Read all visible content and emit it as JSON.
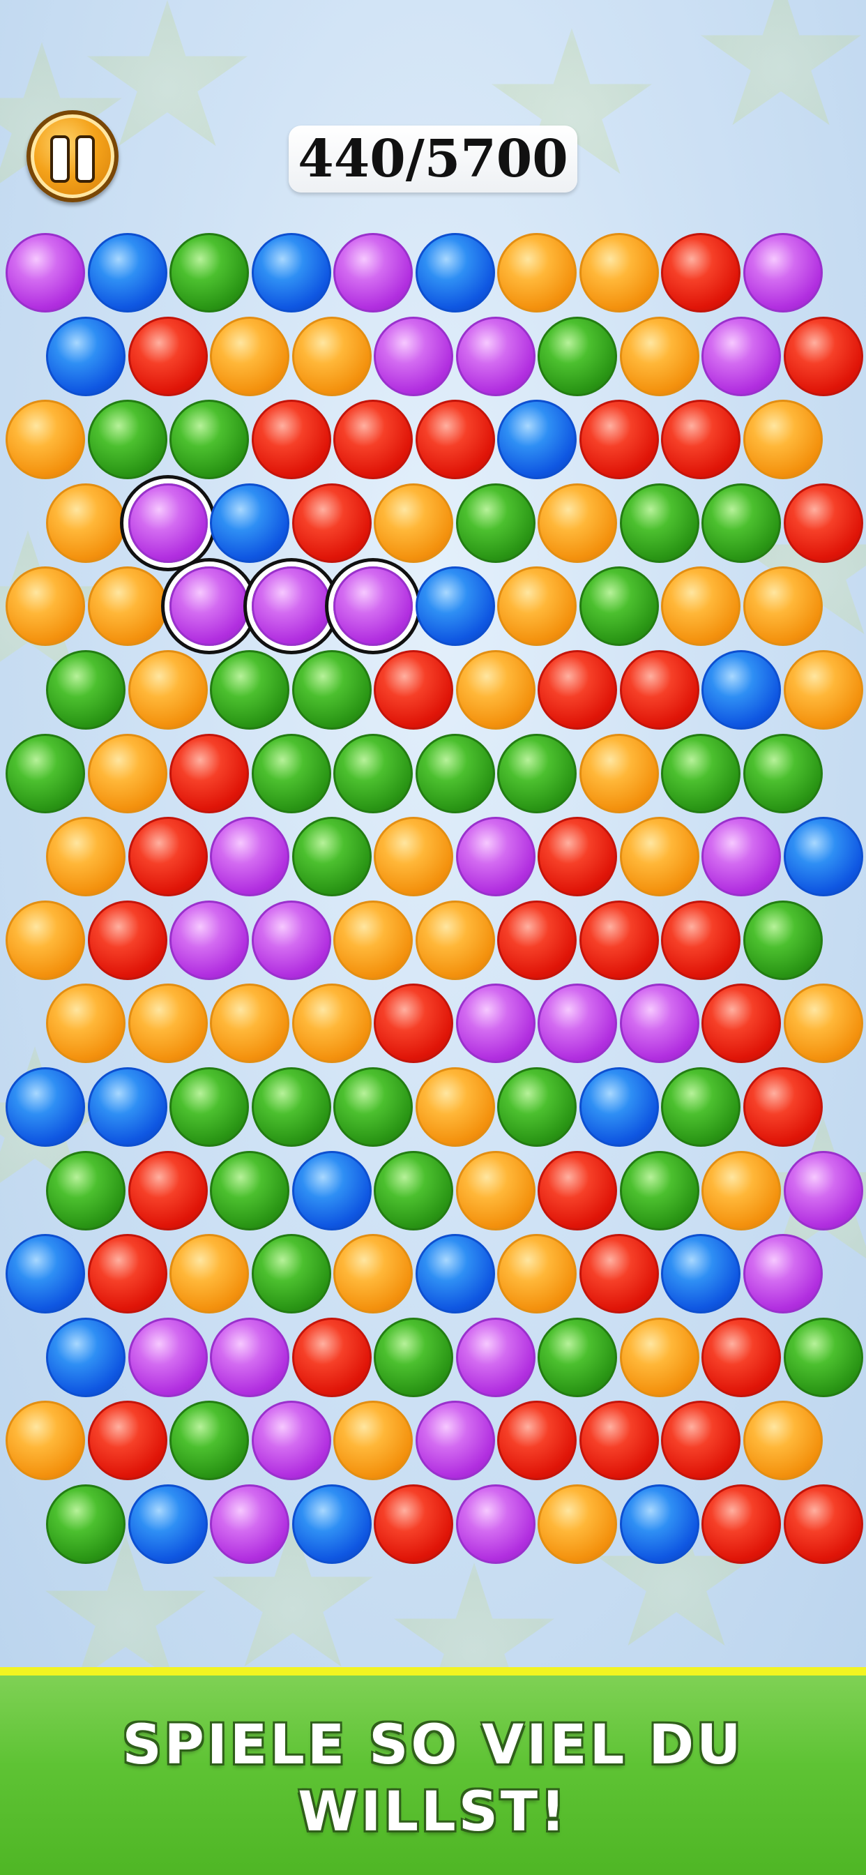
{
  "hud": {
    "score": "440/5700",
    "pause_icon": "pause-icon"
  },
  "board": {
    "rows": [
      [
        "purple",
        "blue",
        "green",
        "blue",
        "purple",
        "blue",
        "orange",
        "orange",
        "red",
        "purple"
      ],
      [
        "blue",
        "red",
        "orange",
        "orange",
        "purple",
        "purple",
        "green",
        "orange",
        "purple",
        "red"
      ],
      [
        "orange",
        "green",
        "green",
        "red",
        "red",
        "red",
        "blue",
        "red",
        "red",
        "orange"
      ],
      [
        "orange",
        "purple",
        "blue",
        "red",
        "orange",
        "green",
        "orange",
        "green",
        "green",
        "red"
      ],
      [
        "orange",
        "orange",
        "purple",
        "purple",
        "purple",
        "blue",
        "orange",
        "green",
        "orange",
        "orange"
      ],
      [
        "green",
        "orange",
        "green",
        "green",
        "red",
        "orange",
        "red",
        "red",
        "blue",
        "orange"
      ],
      [
        "green",
        "orange",
        "red",
        "green",
        "green",
        "green",
        "green",
        "orange",
        "green",
        "green"
      ],
      [
        "orange",
        "red",
        "purple",
        "green",
        "orange",
        "purple",
        "red",
        "orange",
        "purple",
        "blue"
      ],
      [
        "orange",
        "red",
        "purple",
        "purple",
        "orange",
        "orange",
        "red",
        "red",
        "red",
        "green"
      ],
      [
        "orange",
        "orange",
        "orange",
        "orange",
        "red",
        "purple",
        "purple",
        "purple",
        "red",
        "orange"
      ],
      [
        "blue",
        "blue",
        "green",
        "green",
        "green",
        "orange",
        "green",
        "blue",
        "green",
        "red"
      ],
      [
        "green",
        "red",
        "green",
        "blue",
        "green",
        "orange",
        "red",
        "green",
        "orange",
        "purple"
      ],
      [
        "blue",
        "red",
        "orange",
        "green",
        "orange",
        "blue",
        "orange",
        "red",
        "blue",
        "purple"
      ],
      [
        "blue",
        "purple",
        "purple",
        "red",
        "green",
        "purple",
        "green",
        "orange",
        "red",
        "green"
      ],
      [
        "orange",
        "red",
        "green",
        "purple",
        "orange",
        "purple",
        "red",
        "red",
        "red",
        "orange"
      ],
      [
        "green",
        "blue",
        "purple",
        "blue",
        "red",
        "purple",
        "orange",
        "blue",
        "red",
        "red"
      ]
    ],
    "selected_chain": [
      [
        3,
        1
      ],
      [
        4,
        2
      ],
      [
        4,
        3
      ],
      [
        4,
        4
      ]
    ]
  },
  "footer": {
    "line1": "SPIELE SO VIEL DU",
    "line2": "WILLST!"
  }
}
